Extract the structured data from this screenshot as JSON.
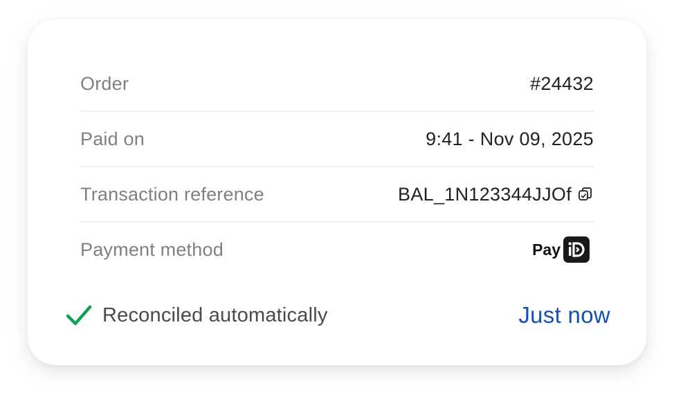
{
  "details": {
    "rows": [
      {
        "label": "Order",
        "value": "#24432"
      },
      {
        "label": "Paid on",
        "value": "9:41 - Nov 09, 2025"
      },
      {
        "label": "Transaction reference",
        "value": "BAL_1N123344JJOf"
      },
      {
        "label": "Payment method",
        "value": "Pay"
      }
    ],
    "icons": {
      "copy": "copy-icon",
      "payid_logo": "payid-logo"
    }
  },
  "footer": {
    "status_text": "Reconciled automatically",
    "status_icon": "check-icon",
    "status_color": "#12a150",
    "time_text": "Just now",
    "time_color": "#1151b4"
  }
}
